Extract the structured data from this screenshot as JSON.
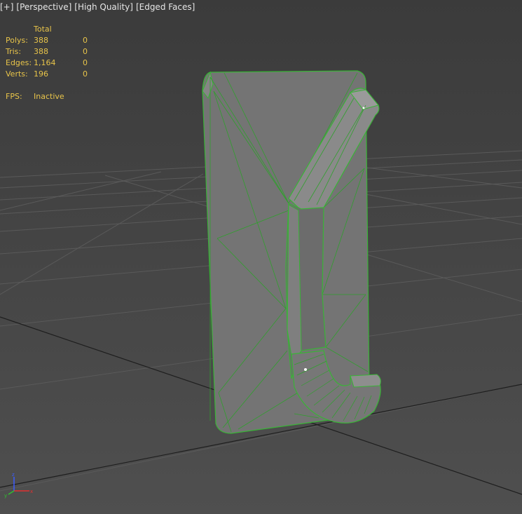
{
  "viewport": {
    "labels": [
      "[+]",
      "[Perspective]",
      "[High Quality]",
      "[Edged Faces]"
    ]
  },
  "stats": {
    "header": "Total",
    "rows": [
      {
        "label": "Polys:",
        "total": "388",
        "selected": "0"
      },
      {
        "label": "Tris:",
        "total": "388",
        "selected": "0"
      },
      {
        "label": "Edges:",
        "total": "1,164",
        "selected": "0"
      },
      {
        "label": "Verts:",
        "total": "196",
        "selected": "0"
      }
    ],
    "fps_label": "FPS:",
    "fps_value": "Inactive"
  },
  "colors": {
    "background": "#444444",
    "grid": "#5c5c5c",
    "object_fill": "#7a7a7a",
    "object_edges": "#39b436",
    "stats_text": "#e8c44a",
    "label_text": "#e6e6e6"
  },
  "icons": {
    "axis_tripod": "axis-tripod-icon"
  }
}
